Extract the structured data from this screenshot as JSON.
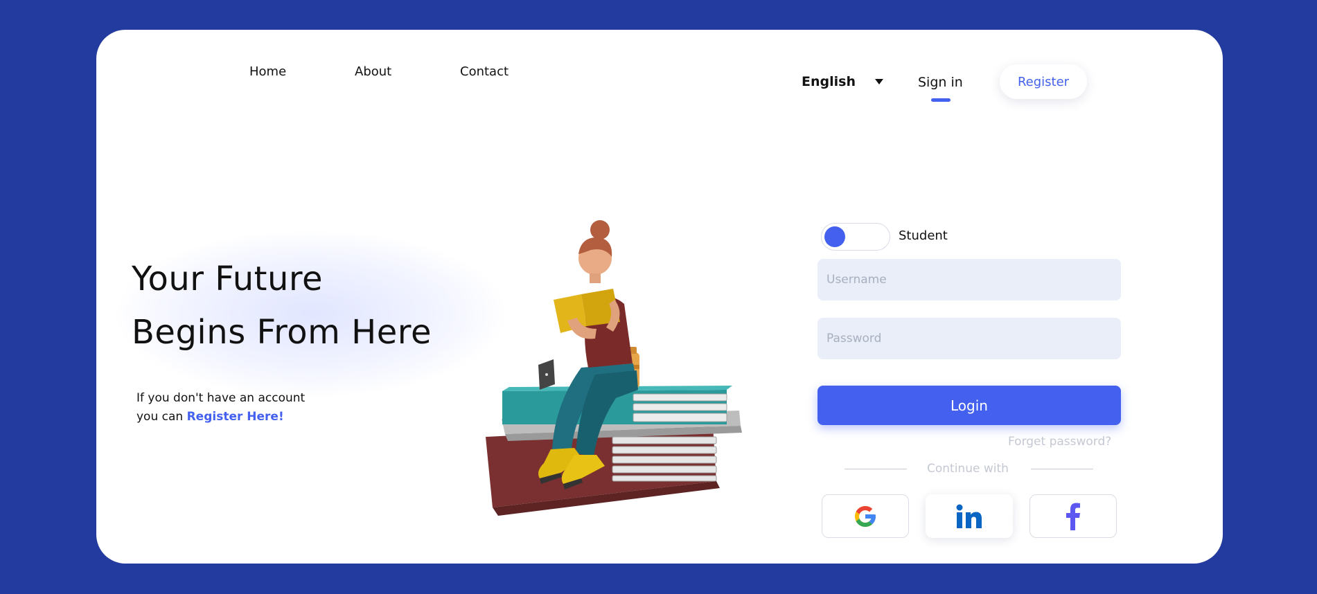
{
  "nav": {
    "links": [
      "Home",
      "About",
      "Contact"
    ],
    "language": "English",
    "sign_in": "Sign in",
    "register": "Register"
  },
  "hero": {
    "title_line1": "Your Future",
    "title_line2": "Begins From Here",
    "sub_line1": "If you don't have an account",
    "sub_line2_prefix": "you can",
    "register_link": "Register Here!"
  },
  "form": {
    "role_label": "Student",
    "username_placeholder": "Username",
    "password_placeholder": "Password",
    "login_label": "Login",
    "forgot_label": "Forget password?",
    "continue_label": "Continue with",
    "social": [
      "google-icon",
      "linkedin-icon",
      "facebook-icon"
    ]
  },
  "colors": {
    "background": "#233a9e",
    "accent": "#4361ee",
    "field": "#e9eef8"
  }
}
